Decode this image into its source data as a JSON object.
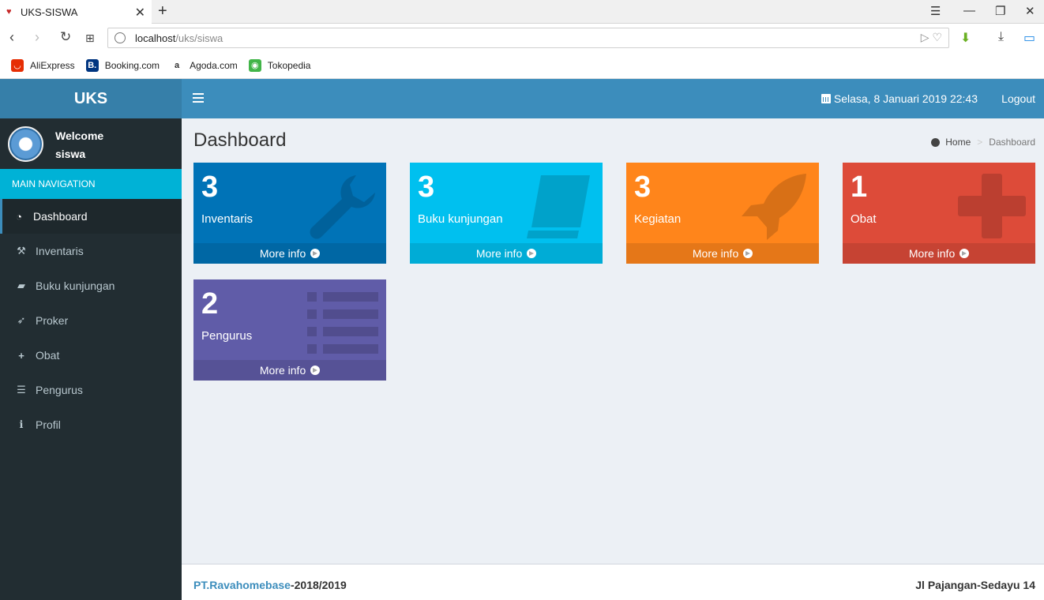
{
  "browser": {
    "tab_title": "UKS-SISWA",
    "url_host": "localhost",
    "url_path": "/uks/siswa",
    "bookmarks": [
      {
        "label": "AliExpress",
        "color": "#e62e04"
      },
      {
        "label": "Booking.com",
        "color": "#003580"
      },
      {
        "label": "Agoda.com",
        "color": "#ffffff"
      },
      {
        "label": "Tokopedia",
        "color": "#42b549"
      }
    ]
  },
  "header": {
    "logo": "UKS",
    "date": "Selasa, 8 Januari 2019 22:43",
    "logout": "Logout"
  },
  "sidebar": {
    "welcome": "Welcome",
    "username": "siswa",
    "nav_header": "MAIN NAVIGATION",
    "items": [
      {
        "label": "Dashboard",
        "icon": "dashboard-icon"
      },
      {
        "label": "Inventaris",
        "icon": "wrench-icon"
      },
      {
        "label": "Buku kunjungan",
        "icon": "book-icon"
      },
      {
        "label": "Proker",
        "icon": "rocket-icon"
      },
      {
        "label": "Obat",
        "icon": "plus-icon"
      },
      {
        "label": "Pengurus",
        "icon": "list-icon"
      },
      {
        "label": "Profil",
        "icon": "info-icon"
      }
    ]
  },
  "page": {
    "title": "Dashboard",
    "breadcrumb_home": "Home",
    "breadcrumb_current": "Dashboard"
  },
  "boxes": [
    {
      "count": "3",
      "label": "Inventaris",
      "more": "More info",
      "color": "#0073b7",
      "icon": "wrench-icon"
    },
    {
      "count": "3",
      "label": "Buku kunjungan",
      "more": "More info",
      "color": "#00c0ef",
      "icon": "book-icon"
    },
    {
      "count": "3",
      "label": "Kegiatan",
      "more": "More info",
      "color": "#ff851b",
      "icon": "rocket-icon"
    },
    {
      "count": "1",
      "label": "Obat",
      "more": "More info",
      "color": "#dd4b39",
      "icon": "plus-icon"
    },
    {
      "count": "2",
      "label": "Pengurus",
      "more": "More info",
      "color": "#605ca8",
      "icon": "list-icon"
    }
  ],
  "footer": {
    "company": "PT.Ravahomebase",
    "years": "-2018/2019",
    "address": "Jl Pajangan-Sedayu 14"
  }
}
